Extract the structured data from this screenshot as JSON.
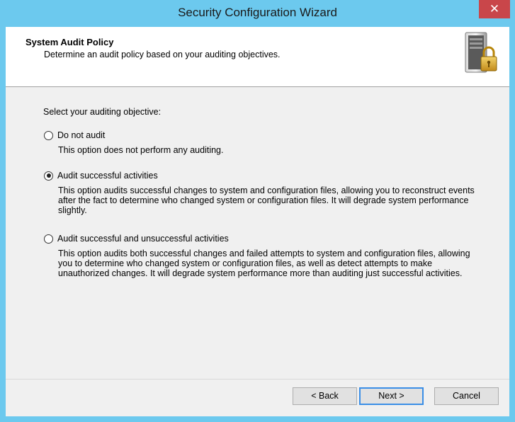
{
  "window": {
    "title": "Security Configuration Wizard",
    "close_glyph": "✕"
  },
  "header": {
    "title": "System Audit Policy",
    "subtitle": "Determine an audit policy based on your auditing objectives.",
    "icon": "server-lock-icon"
  },
  "content": {
    "prompt": "Select your auditing objective:",
    "options": [
      {
        "label": "Do not audit",
        "description": "This option does not perform any auditing.",
        "selected": false
      },
      {
        "label": "Audit successful activities",
        "description": "This option audits successful changes to system and configuration files, allowing you to reconstruct events after the fact to determine who changed system or configuration files. It will degrade system performance slightly.",
        "selected": true
      },
      {
        "label": "Audit successful and unsuccessful activities",
        "description": "This option audits both successful changes and failed attempts to system and configuration files, allowing you to determine who changed system or configuration files, as well as detect attempts to make unauthorized changes. It will degrade system performance more than auditing just successful activities.",
        "selected": false
      }
    ]
  },
  "buttons": {
    "back": "< Back",
    "next": "Next >",
    "cancel": "Cancel"
  },
  "colors": {
    "titlebar": "#6cc9ee",
    "close": "#c9464a",
    "client": "#f0f0f0",
    "header": "#ffffff"
  }
}
